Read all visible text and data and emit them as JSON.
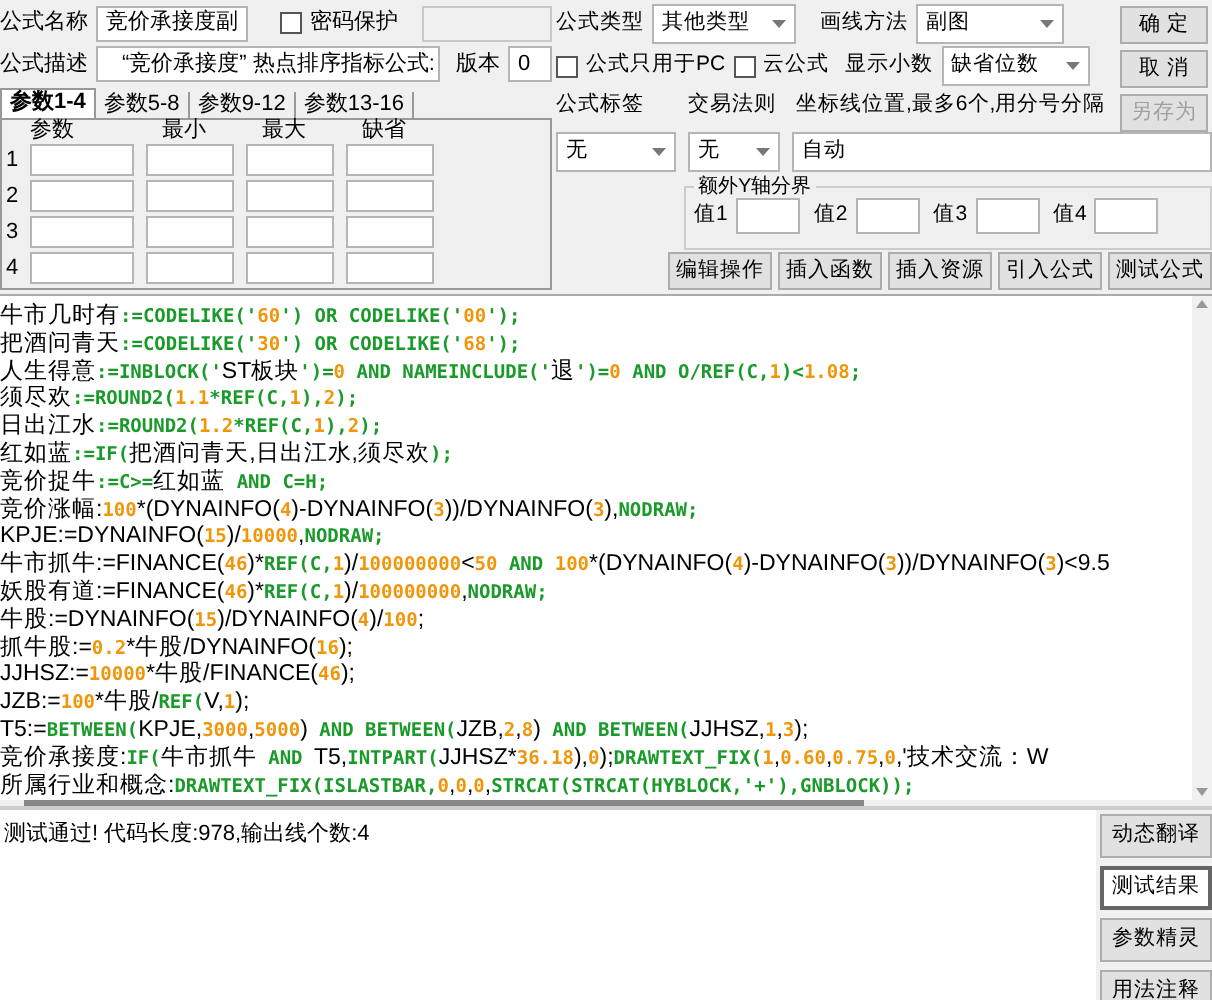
{
  "formula_name": {
    "label": "公式名称",
    "value": "竞价承接度副"
  },
  "password_protect": {
    "label": "密码保护",
    "checked": false
  },
  "description": {
    "label": "公式描述",
    "value": "“竞价承接度” 热点排序指标公式:"
  },
  "version": {
    "label": "版本",
    "value": "0"
  },
  "formula_type": {
    "label": "公式类型",
    "value": "其他类型"
  },
  "draw_method": {
    "label": "画线方法",
    "value": "副图"
  },
  "pc_only": {
    "label": "公式只用于PC",
    "checked": false
  },
  "cloud": {
    "label": "云公式",
    "checked": false
  },
  "decimals": {
    "label": "显示小数",
    "value": "缺省位数"
  },
  "action_buttons": [
    {
      "label": "确 定",
      "disabled": false
    },
    {
      "label": "取 消",
      "disabled": false
    },
    {
      "label": "另存为",
      "disabled": true
    }
  ],
  "param_tabs": [
    {
      "label": "参数1-4",
      "selected": true
    },
    {
      "label": "参数5-8",
      "selected": false
    },
    {
      "label": "参数9-12",
      "selected": false
    },
    {
      "label": "参数13-16",
      "selected": false
    }
  ],
  "param_table": {
    "columns": [
      "参数",
      "最小",
      "最大",
      "缺省"
    ],
    "rows": [
      "1",
      "2",
      "3",
      "4"
    ]
  },
  "tag": {
    "label": "公式标签",
    "value": "无"
  },
  "trade_rule": {
    "label": "交易法则",
    "value": "无"
  },
  "axis_lines": {
    "label": "坐标线位置,最多6个,用分号分隔",
    "value": "自动"
  },
  "y_bounds": {
    "title": "额外Y轴分界",
    "fields": [
      "值1",
      "值2",
      "值3",
      "值4"
    ]
  },
  "toolbar_buttons": [
    "编辑操作",
    "插入函数",
    "插入资源",
    "引入公式",
    "测试公式"
  ],
  "code_lines": [
    [
      {
        "kind": "text",
        "text": "牛市几时有"
      },
      {
        "kind": "func",
        "text": ":=CODELIKE('"
      },
      {
        "kind": "num",
        "text": "60"
      },
      {
        "kind": "func",
        "text": "') OR CODELIKE('"
      },
      {
        "kind": "num",
        "text": "00"
      },
      {
        "kind": "func",
        "text": "');"
      }
    ],
    [
      {
        "kind": "text",
        "text": "把酒问青天"
      },
      {
        "kind": "func",
        "text": ":=CODELIKE('"
      },
      {
        "kind": "num",
        "text": "30"
      },
      {
        "kind": "func",
        "text": "') OR CODELIKE('"
      },
      {
        "kind": "num",
        "text": "68"
      },
      {
        "kind": "func",
        "text": "');"
      }
    ],
    [
      {
        "kind": "text",
        "text": "人生得意"
      },
      {
        "kind": "func",
        "text": ":=INBLOCK('"
      },
      {
        "kind": "text",
        "text": "ST板块"
      },
      {
        "kind": "func",
        "text": "')="
      },
      {
        "kind": "num",
        "text": "0"
      },
      {
        "kind": "func",
        "text": " AND NAMEINCLUDE('"
      },
      {
        "kind": "text",
        "text": "退"
      },
      {
        "kind": "func",
        "text": "')="
      },
      {
        "kind": "num",
        "text": "0"
      },
      {
        "kind": "func",
        "text": " AND O/REF(C,"
      },
      {
        "kind": "num",
        "text": "1"
      },
      {
        "kind": "func",
        "text": ")<"
      },
      {
        "kind": "num",
        "text": "1.08"
      },
      {
        "kind": "func",
        "text": ";"
      }
    ],
    [
      {
        "kind": "text",
        "text": "须尽欢"
      },
      {
        "kind": "func",
        "text": ":=ROUND2("
      },
      {
        "kind": "num",
        "text": "1.1"
      },
      {
        "kind": "func",
        "text": "*REF(C,"
      },
      {
        "kind": "num",
        "text": "1"
      },
      {
        "kind": "func",
        "text": "),"
      },
      {
        "kind": "num",
        "text": "2"
      },
      {
        "kind": "func",
        "text": ");"
      }
    ],
    [
      {
        "kind": "text",
        "text": "日出江水"
      },
      {
        "kind": "func",
        "text": ":=ROUND2("
      },
      {
        "kind": "num",
        "text": "1.2"
      },
      {
        "kind": "func",
        "text": "*REF(C,"
      },
      {
        "kind": "num",
        "text": "1"
      },
      {
        "kind": "func",
        "text": "),"
      },
      {
        "kind": "num",
        "text": "2"
      },
      {
        "kind": "func",
        "text": ");"
      }
    ],
    [
      {
        "kind": "text",
        "text": "红如蓝"
      },
      {
        "kind": "func",
        "text": ":=IF("
      },
      {
        "kind": "text",
        "text": "把酒问青天,日出江水,须尽欢"
      },
      {
        "kind": "func",
        "text": ");"
      }
    ],
    [
      {
        "kind": "text",
        "text": "竞价捉牛"
      },
      {
        "kind": "func",
        "text": ":=C>="
      },
      {
        "kind": "text",
        "text": "红如蓝"
      },
      {
        "kind": "func",
        "text": " AND C=H;"
      }
    ],
    [
      {
        "kind": "text",
        "text": "竞价涨幅:"
      },
      {
        "kind": "num",
        "text": "100"
      },
      {
        "kind": "text",
        "text": "*(DYNAINFO("
      },
      {
        "kind": "num",
        "text": "4"
      },
      {
        "kind": "text",
        "text": ")-DYNAINFO("
      },
      {
        "kind": "num",
        "text": "3"
      },
      {
        "kind": "text",
        "text": "))/DYNAINFO("
      },
      {
        "kind": "num",
        "text": "3"
      },
      {
        "kind": "text",
        "text": "),"
      },
      {
        "kind": "func",
        "text": "NODRAW;"
      }
    ],
    [
      {
        "kind": "text",
        "text": "KPJE:=DYNAINFO("
      },
      {
        "kind": "num",
        "text": "15"
      },
      {
        "kind": "text",
        "text": ")/"
      },
      {
        "kind": "num",
        "text": "10000"
      },
      {
        "kind": "text",
        "text": ","
      },
      {
        "kind": "func",
        "text": "NODRAW;"
      }
    ],
    [
      {
        "kind": "text",
        "text": "牛市抓牛:=FINANCE("
      },
      {
        "kind": "num",
        "text": "46"
      },
      {
        "kind": "text",
        "text": ")*"
      },
      {
        "kind": "func",
        "text": "REF(C,"
      },
      {
        "kind": "num",
        "text": "1"
      },
      {
        "kind": "text",
        "text": ")/"
      },
      {
        "kind": "num",
        "text": "100000000"
      },
      {
        "kind": "text",
        "text": "<"
      },
      {
        "kind": "num",
        "text": "50"
      },
      {
        "kind": "func",
        "text": " AND "
      },
      {
        "kind": "num",
        "text": "100"
      },
      {
        "kind": "text",
        "text": "*(DYNAINFO("
      },
      {
        "kind": "num",
        "text": "4"
      },
      {
        "kind": "text",
        "text": ")-DYNAINFO("
      },
      {
        "kind": "num",
        "text": "3"
      },
      {
        "kind": "text",
        "text": "))/DYNAINFO("
      },
      {
        "kind": "num",
        "text": "3"
      },
      {
        "kind": "text",
        "text": ")<9.5"
      }
    ],
    [
      {
        "kind": "text",
        "text": "妖股有道:=FINANCE("
      },
      {
        "kind": "num",
        "text": "46"
      },
      {
        "kind": "text",
        "text": ")*"
      },
      {
        "kind": "func",
        "text": "REF(C,"
      },
      {
        "kind": "num",
        "text": "1"
      },
      {
        "kind": "text",
        "text": ")/"
      },
      {
        "kind": "num",
        "text": "100000000"
      },
      {
        "kind": "text",
        "text": ","
      },
      {
        "kind": "func",
        "text": "NODRAW;"
      }
    ],
    [
      {
        "kind": "text",
        "text": "牛股:=DYNAINFO("
      },
      {
        "kind": "num",
        "text": "15"
      },
      {
        "kind": "text",
        "text": ")/DYNAINFO("
      },
      {
        "kind": "num",
        "text": "4"
      },
      {
        "kind": "text",
        "text": ")/"
      },
      {
        "kind": "num",
        "text": "100"
      },
      {
        "kind": "text",
        "text": ";"
      }
    ],
    [
      {
        "kind": "text",
        "text": "抓牛股:="
      },
      {
        "kind": "num",
        "text": "0.2"
      },
      {
        "kind": "text",
        "text": "*牛股/DYNAINFO("
      },
      {
        "kind": "num",
        "text": "16"
      },
      {
        "kind": "text",
        "text": ");"
      }
    ],
    [
      {
        "kind": "text",
        "text": "JJHSZ:="
      },
      {
        "kind": "num",
        "text": "10000"
      },
      {
        "kind": "text",
        "text": "*牛股/FINANCE("
      },
      {
        "kind": "num",
        "text": "46"
      },
      {
        "kind": "text",
        "text": ");"
      }
    ],
    [
      {
        "kind": "text",
        "text": "JZB:="
      },
      {
        "kind": "num",
        "text": "100"
      },
      {
        "kind": "text",
        "text": "*牛股/"
      },
      {
        "kind": "func",
        "text": "REF("
      },
      {
        "kind": "text",
        "text": "V,"
      },
      {
        "kind": "num",
        "text": "1"
      },
      {
        "kind": "text",
        "text": ");"
      }
    ],
    [
      {
        "kind": "text",
        "text": "T5:="
      },
      {
        "kind": "func",
        "text": "BETWEEN("
      },
      {
        "kind": "text",
        "text": "KPJE,"
      },
      {
        "kind": "num",
        "text": "3000"
      },
      {
        "kind": "text",
        "text": ","
      },
      {
        "kind": "num",
        "text": "5000"
      },
      {
        "kind": "text",
        "text": ")"
      },
      {
        "kind": "func",
        "text": " AND BETWEEN("
      },
      {
        "kind": "text",
        "text": "JZB,"
      },
      {
        "kind": "num",
        "text": "2"
      },
      {
        "kind": "text",
        "text": ","
      },
      {
        "kind": "num",
        "text": "8"
      },
      {
        "kind": "text",
        "text": ")"
      },
      {
        "kind": "func",
        "text": " AND BETWEEN("
      },
      {
        "kind": "text",
        "text": "JJHSZ,"
      },
      {
        "kind": "num",
        "text": "1"
      },
      {
        "kind": "text",
        "text": ","
      },
      {
        "kind": "num",
        "text": "3"
      },
      {
        "kind": "text",
        "text": ");"
      }
    ],
    [
      {
        "kind": "text",
        "text": "竞价承接度:"
      },
      {
        "kind": "func",
        "text": "IF("
      },
      {
        "kind": "text",
        "text": "牛市抓牛"
      },
      {
        "kind": "func",
        "text": " AND "
      },
      {
        "kind": "text",
        "text": "T5,"
      },
      {
        "kind": "func",
        "text": "INTPART("
      },
      {
        "kind": "text",
        "text": "JJHSZ*"
      },
      {
        "kind": "num",
        "text": "36.18"
      },
      {
        "kind": "text",
        "text": "),"
      },
      {
        "kind": "num",
        "text": "0"
      },
      {
        "kind": "text",
        "text": ");"
      },
      {
        "kind": "func",
        "text": "DRAWTEXT_FIX("
      },
      {
        "kind": "num",
        "text": "1"
      },
      {
        "kind": "text",
        "text": ","
      },
      {
        "kind": "num",
        "text": "0.60"
      },
      {
        "kind": "text",
        "text": ","
      },
      {
        "kind": "num",
        "text": "0.75"
      },
      {
        "kind": "text",
        "text": ","
      },
      {
        "kind": "num",
        "text": "0"
      },
      {
        "kind": "text",
        "text": ",'技术交流：W"
      }
    ],
    [
      {
        "kind": "text",
        "text": "所属行业和概念:"
      },
      {
        "kind": "func",
        "text": "DRAWTEXT_FIX(ISLASTBAR,"
      },
      {
        "kind": "num",
        "text": "0"
      },
      {
        "kind": "text",
        "text": ","
      },
      {
        "kind": "num",
        "text": "0"
      },
      {
        "kind": "text",
        "text": ","
      },
      {
        "kind": "num",
        "text": "0"
      },
      {
        "kind": "text",
        "text": ","
      },
      {
        "kind": "func",
        "text": "STRCAT(STRCAT(HYBLOCK,'+'),GNBLOCK));"
      }
    ]
  ],
  "output": "测试通过! 代码长度:978,输出线个数:4",
  "side_buttons": [
    {
      "label": "动态翻译",
      "selected": false
    },
    {
      "label": "测试结果",
      "selected": true
    },
    {
      "label": "参数精灵",
      "selected": false
    },
    {
      "label": "用法注释",
      "selected": false
    }
  ]
}
